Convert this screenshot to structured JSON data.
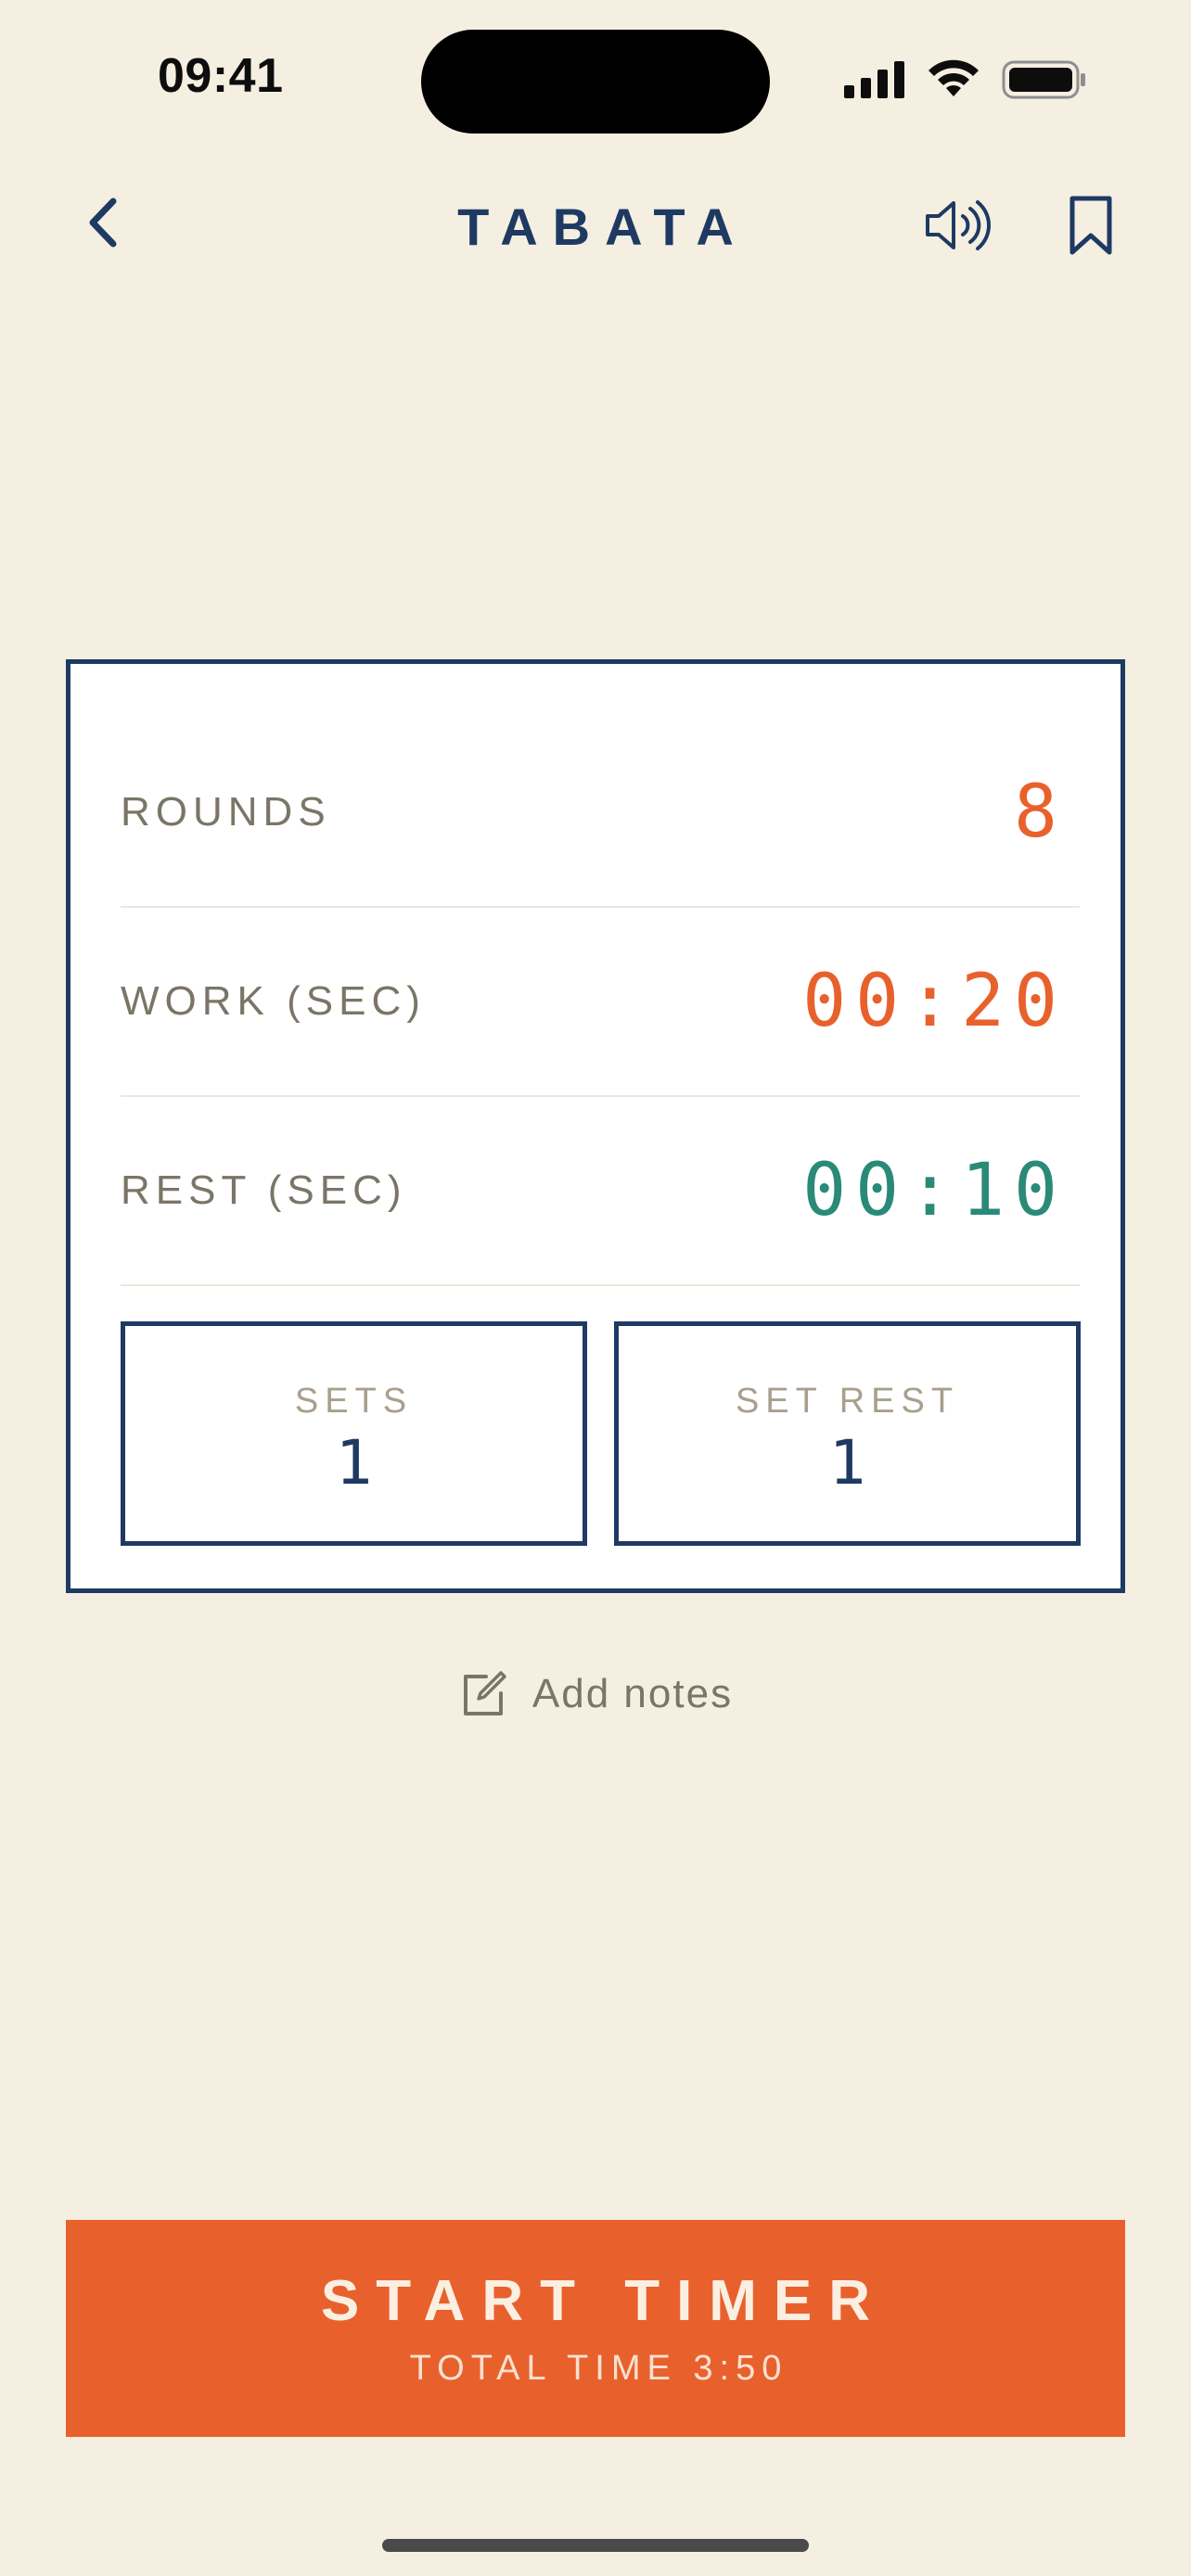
{
  "status_bar": {
    "time": "09:41"
  },
  "header": {
    "title": "TABATA",
    "back_icon": "chevron-left-icon",
    "sound_icon": "speaker-icon",
    "bookmark_icon": "bookmark-icon"
  },
  "settings": {
    "rounds": {
      "label": "ROUNDS",
      "value": "8"
    },
    "work": {
      "label": "WORK (SEC)",
      "value": "00:20"
    },
    "rest": {
      "label": "REST (SEC)",
      "value": "00:10"
    },
    "sets": {
      "label": "SETS",
      "value": "1"
    },
    "set_rest": {
      "label": "SET REST",
      "value": "1"
    }
  },
  "notes": {
    "label": "Add notes",
    "icon": "edit-note-icon"
  },
  "start_button": {
    "title": "START TIMER",
    "subtitle": "TOTAL TIME 3:50"
  },
  "colors": {
    "background": "#f4efe1",
    "navy": "#1e3a63",
    "accent_orange": "#e8612d",
    "accent_green": "#2a8a78",
    "muted_text": "#7b7567"
  }
}
